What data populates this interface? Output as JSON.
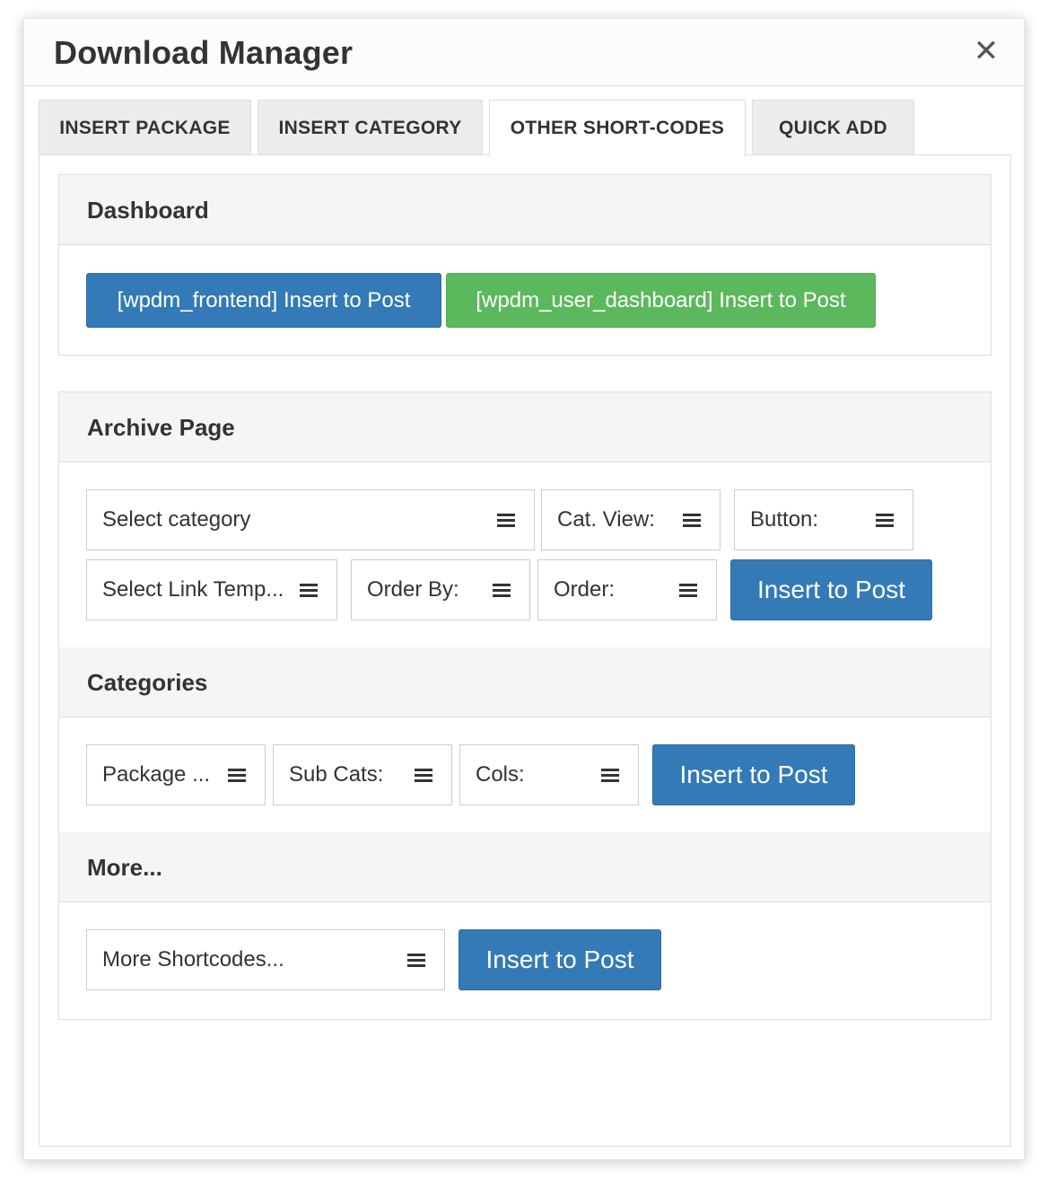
{
  "dialog": {
    "title": "Download Manager",
    "close_glyph": "✕"
  },
  "tabs": [
    {
      "label": "INSERT PACKAGE"
    },
    {
      "label": "INSERT CATEGORY"
    },
    {
      "label": "OTHER SHORT-CODES",
      "active": true
    },
    {
      "label": "QUICK ADD"
    }
  ],
  "dashboard": {
    "heading": "Dashboard",
    "frontend_button": "[wpdm_frontend] Insert to Post",
    "user_dashboard_button": "[wpdm_user_dashboard] Insert to Post"
  },
  "archive": {
    "heading": "Archive Page",
    "select_category": "Select category",
    "cat_view": "Cat. View:",
    "button": "Button:",
    "link_template": "Select Link Temp...",
    "order_by": "Order By:",
    "order": "Order:",
    "insert_button": "Insert to Post"
  },
  "categories": {
    "heading": "Categories",
    "package": "Package ...",
    "sub_cats": "Sub Cats:",
    "cols": "Cols:",
    "insert_button": "Insert to Post"
  },
  "more": {
    "heading": "More...",
    "more_shortcodes": "More Shortcodes...",
    "insert_button": "Insert to Post"
  },
  "colors": {
    "primary": "#337ab7",
    "success": "#5cb85c",
    "panel_heading_bg": "#f5f5f5",
    "border": "#dddddd"
  },
  "icons": {
    "close": "close-icon",
    "select_toggle": "hamburger-icon"
  }
}
